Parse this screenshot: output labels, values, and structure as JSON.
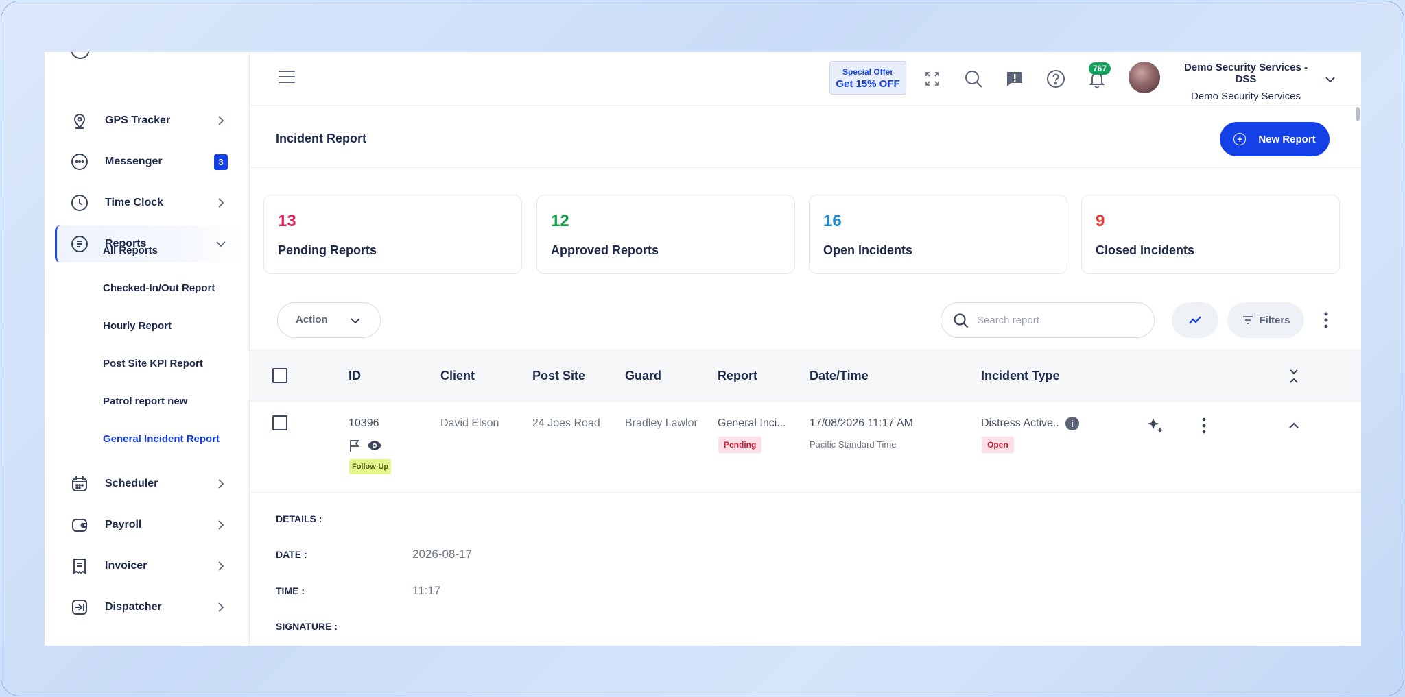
{
  "sidebar": {
    "items": [
      {
        "label": "GPS Tracker",
        "icon": "location-pin-icon"
      },
      {
        "label": "Messenger",
        "icon": "chat-bubble-icon",
        "badge": "3"
      },
      {
        "label": "Time Clock",
        "icon": "clock-icon"
      },
      {
        "label": "Reports",
        "icon": "document-icon"
      },
      {
        "label": "Scheduler",
        "icon": "calendar-icon"
      },
      {
        "label": "Payroll",
        "icon": "wallet-icon"
      },
      {
        "label": "Invoicer",
        "icon": "receipt-icon"
      },
      {
        "label": "Dispatcher",
        "icon": "dispatch-arrow-icon"
      }
    ],
    "report_subitems": [
      "All Reports",
      "Checked-In/Out Report",
      "Hourly Report",
      "Post Site KPI Report",
      "Patrol report new",
      "General Incident Report"
    ]
  },
  "topbar": {
    "offer_line1": "Special Offer",
    "offer_line2": "Get 15% OFF",
    "notification_count": "767",
    "company_name": "Demo Security Services - DSS",
    "company_sub": "Demo Security Services"
  },
  "page": {
    "title": "Incident Report",
    "new_report_label": "New Report"
  },
  "stats": [
    {
      "value": "13",
      "label": "Pending Reports",
      "color": "#e0245e"
    },
    {
      "value": "12",
      "label": "Approved Reports",
      "color": "#16a34a"
    },
    {
      "value": "16",
      "label": "Open Incidents",
      "color": "#1e88c8"
    },
    {
      "value": "9",
      "label": "Closed Incidents",
      "color": "#e53935"
    }
  ],
  "toolbar": {
    "action_label": "Action",
    "search_placeholder": "Search report",
    "filters_label": "Filters"
  },
  "table": {
    "headers": [
      "ID",
      "Client",
      "Post Site",
      "Guard",
      "Report",
      "Date/Time",
      "Incident Type"
    ],
    "row": {
      "id": "10396",
      "follow_up": "Follow-Up",
      "client": "David Elson",
      "post_site": "24 Joes Road",
      "guard": "Bradley Lawlor",
      "report": "General Inci...",
      "report_status": "Pending",
      "datetime": "17/08/2026 11:17 AM",
      "timezone": "Pacific Standard Time",
      "incident_type": "Distress Active..",
      "incident_status": "Open"
    }
  },
  "details": {
    "header": "DETAILS :",
    "date_label": "DATE :",
    "date_value": "2026-08-17",
    "time_label": "TIME :",
    "time_value": "11:17",
    "signature_label": "SIGNATURE :"
  },
  "colors": {
    "accent": "#1440e8",
    "text": "#1d2a4e"
  }
}
